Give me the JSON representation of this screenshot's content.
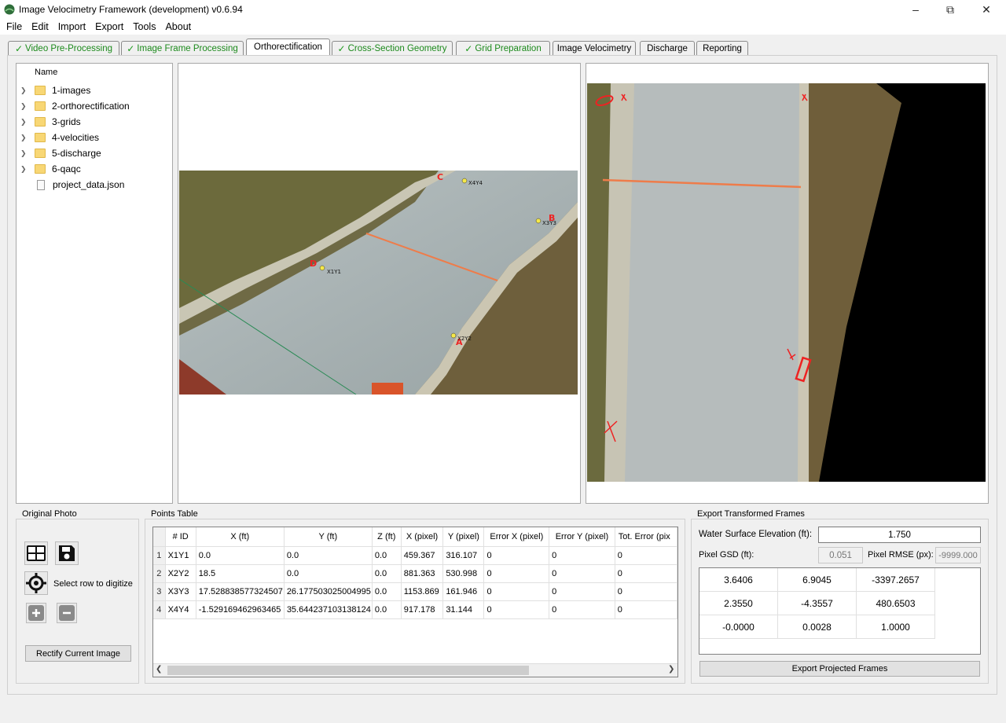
{
  "window": {
    "title": "Image Velocimetry Framework (development) v0.6.94"
  },
  "menu": [
    "File",
    "Edit",
    "Import",
    "Export",
    "Tools",
    "About"
  ],
  "tabs": [
    {
      "label": "Video Pre-Processing",
      "done": true
    },
    {
      "label": "Image Frame Processing",
      "done": true
    },
    {
      "label": "Orthorectification",
      "done": false,
      "active": true
    },
    {
      "label": "Cross-Section Geometry",
      "done": true
    },
    {
      "label": "Grid Preparation",
      "done": true
    },
    {
      "label": "Image Velocimetry",
      "done": false
    },
    {
      "label": "Discharge",
      "done": false
    },
    {
      "label": "Reporting",
      "done": false
    }
  ],
  "tree": {
    "header": "Name",
    "items": [
      {
        "label": "1-images",
        "type": "folder"
      },
      {
        "label": "2-orthorectification",
        "type": "folder"
      },
      {
        "label": "3-grids",
        "type": "folder"
      },
      {
        "label": "4-velocities",
        "type": "folder"
      },
      {
        "label": "5-discharge",
        "type": "folder"
      },
      {
        "label": "6-qaqc",
        "type": "folder"
      },
      {
        "label": "project_data.json",
        "type": "file"
      }
    ]
  },
  "image_labels": {
    "left": [
      "C",
      "X4Y4",
      "B",
      "X3Y3",
      "D",
      "X1Y1",
      "A",
      "X2Y2"
    ]
  },
  "original_photo": {
    "title": "Original Photo",
    "digitize_label": "Select row to digitize",
    "rectify_button": "Rectify Current Image"
  },
  "points_table": {
    "title": "Points Table",
    "columns": [
      "# ID",
      "X (ft)",
      "Y (ft)",
      "Z (ft)",
      "X (pixel)",
      "Y (pixel)",
      "Error X (pixel)",
      "Error Y (pixel)",
      "Tot. Error (pix"
    ],
    "rows": [
      {
        "n": "1",
        "cells": [
          "X1Y1",
          "0.0",
          "0.0",
          "0.0",
          "459.367",
          "316.107",
          "0",
          "0",
          "0"
        ]
      },
      {
        "n": "2",
        "cells": [
          "X2Y2",
          "18.5",
          "0.0",
          "0.0",
          "881.363",
          "530.998",
          "0",
          "0",
          "0"
        ]
      },
      {
        "n": "3",
        "cells": [
          "X3Y3",
          "17.528838577324507",
          "26.177503025004995",
          "0.0",
          "1153.869",
          "161.946",
          "0",
          "0",
          "0"
        ]
      },
      {
        "n": "4",
        "cells": [
          "X4Y4",
          "-1.529169462963465",
          "35.644237103138124",
          "0.0",
          "917.178",
          "31.144",
          "0",
          "0",
          "0"
        ]
      }
    ]
  },
  "export": {
    "title": "Export Transformed Frames",
    "wse_label": "Water Surface Elevation (ft):",
    "wse_value": "1.750",
    "gsd_label": "Pixel GSD (ft):",
    "gsd_value": "0.051",
    "rmse_label": "Pixel RMSE (px):",
    "rmse_value": "-9999.000",
    "matrix": [
      [
        "3.6406",
        "6.9045",
        "-3397.2657"
      ],
      [
        "2.3550",
        "-4.3557",
        "480.6503"
      ],
      [
        "-0.0000",
        "0.0028",
        "1.0000"
      ]
    ],
    "button": "Export Projected Frames"
  }
}
